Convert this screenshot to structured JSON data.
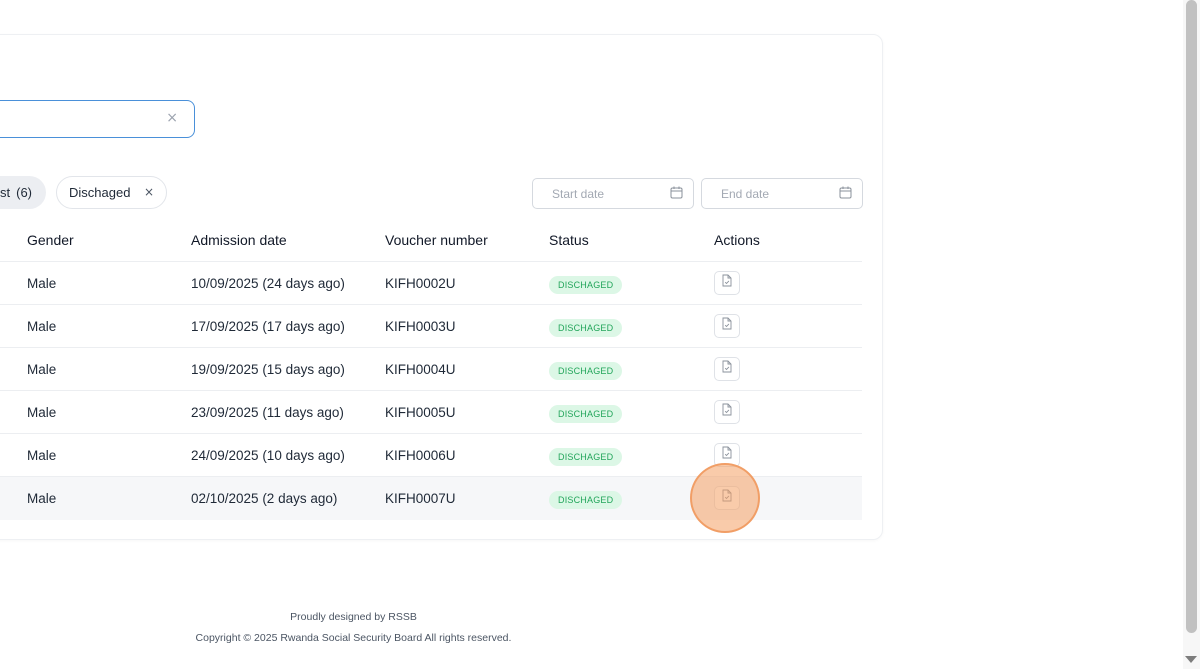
{
  "search": {
    "value": "",
    "clear_icon": "×"
  },
  "filters": {
    "all_label": "st",
    "all_count": "(6)",
    "discharged_label": "Dischaged",
    "remove_icon": "×"
  },
  "date_range": {
    "start_placeholder": "Start date",
    "end_placeholder": "End date"
  },
  "table": {
    "headers": {
      "gender": "Gender",
      "admission_date": "Admission date",
      "voucher_number": "Voucher number",
      "status": "Status",
      "actions": "Actions"
    },
    "rows": [
      {
        "gender": "Male",
        "admission_date": "10/09/2025 (24 days ago)",
        "voucher": "KIFH0002U",
        "status": "DISCHAGED"
      },
      {
        "gender": "Male",
        "admission_date": "17/09/2025 (17 days ago)",
        "voucher": "KIFH0003U",
        "status": "DISCHAGED"
      },
      {
        "gender": "Male",
        "admission_date": "19/09/2025 (15 days ago)",
        "voucher": "KIFH0004U",
        "status": "DISCHAGED"
      },
      {
        "gender": "Male",
        "admission_date": "23/09/2025 (11 days ago)",
        "voucher": "KIFH0005U",
        "status": "DISCHAGED"
      },
      {
        "gender": "Male",
        "admission_date": "24/09/2025 (10 days ago)",
        "voucher": "KIFH0006U",
        "status": "DISCHAGED"
      },
      {
        "gender": "Male",
        "admission_date": "02/10/2025 (2 days ago)",
        "voucher": "KIFH0007U",
        "status": "DISCHAGED"
      }
    ]
  },
  "footer": {
    "designed_by": "Proudly designed by RSSB",
    "copyright": "Copyright © 2025 Rwanda Social Security Board All rights reserved."
  },
  "colors": {
    "accent_border": "#4a90d9",
    "badge_bg": "#dcf7e6",
    "badge_text": "#22a55a",
    "click_highlight": "#f4a064"
  }
}
